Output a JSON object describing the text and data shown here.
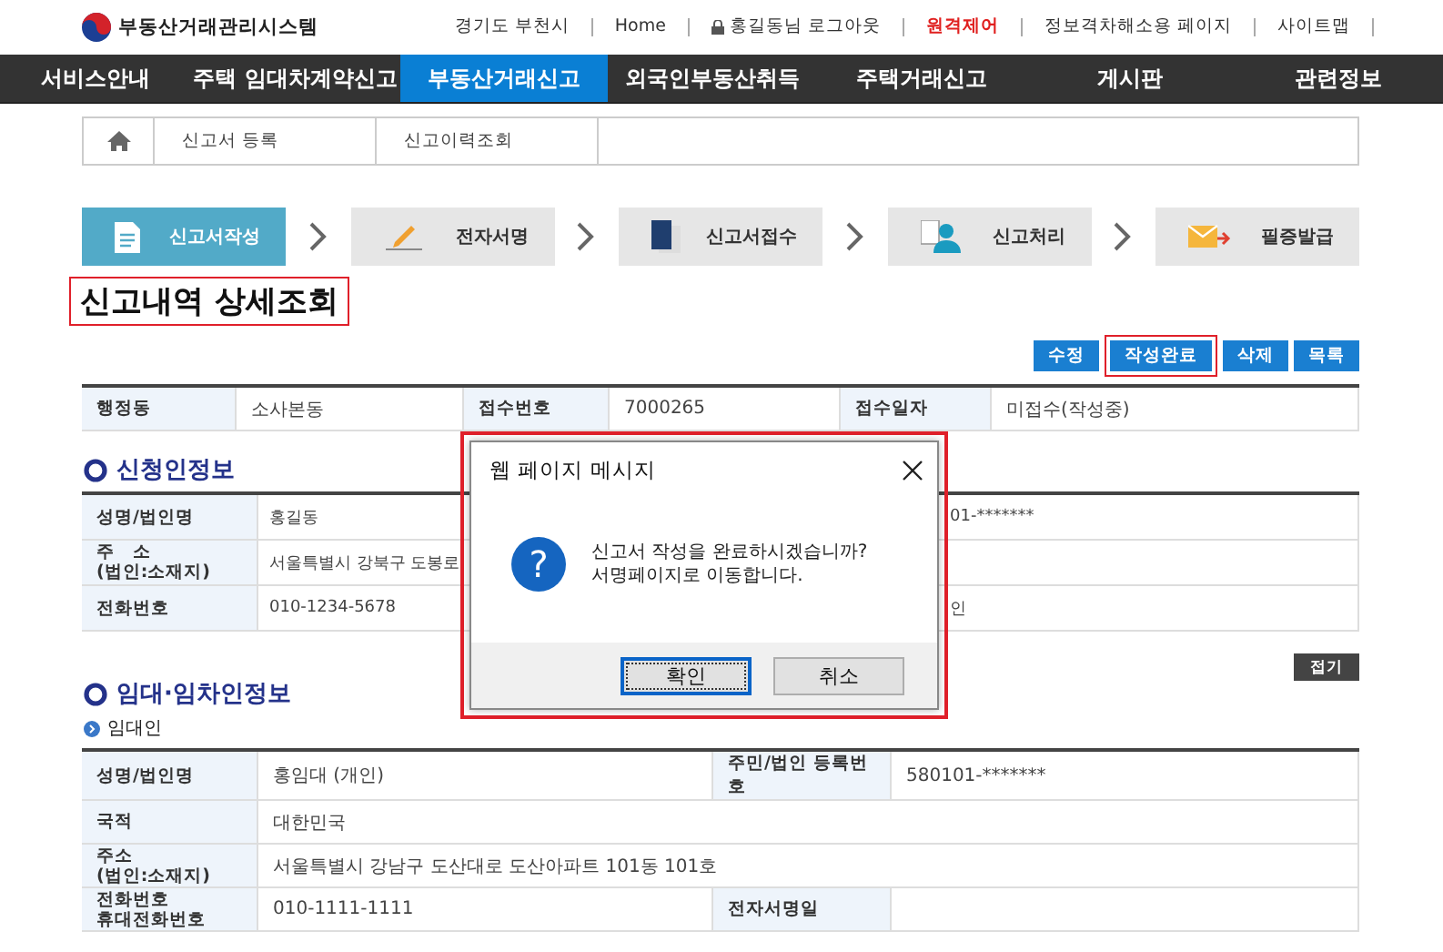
{
  "header": {
    "logo": "부동산거래관리시스템",
    "links": [
      {
        "label": "경기도 부천시",
        "kind": "text"
      },
      {
        "label": "Home",
        "kind": "link"
      },
      {
        "label": "홍길동님 로그아웃",
        "kind": "lock"
      },
      {
        "label": "원격제어",
        "kind": "alert"
      },
      {
        "label": "정보격차해소용 페이지",
        "kind": "link"
      },
      {
        "label": "사이트맵",
        "kind": "link"
      }
    ]
  },
  "nav": [
    {
      "label": "서비스안내",
      "selected": false
    },
    {
      "label": "주택 임대차계약신고",
      "selected": false
    },
    {
      "label": "부동산거래신고",
      "selected": true
    },
    {
      "label": "외국인부동산취득",
      "selected": false
    },
    {
      "label": "주택거래신고",
      "selected": false
    },
    {
      "label": "게시판",
      "selected": false
    },
    {
      "label": "관련정보",
      "selected": false
    }
  ],
  "breadcrumb": [
    "신고서 등록",
    "신고이력조회"
  ],
  "steps": [
    {
      "label": "신고서작성",
      "kind": "document",
      "selected": true
    },
    {
      "label": "전자서명",
      "kind": "pen",
      "selected": false
    },
    {
      "label": "신고서접수",
      "kind": "folder",
      "selected": false
    },
    {
      "label": "신고처리",
      "kind": "person",
      "selected": false
    },
    {
      "label": "필증발급",
      "kind": "envelope",
      "selected": false
    }
  ],
  "title": {
    "text": "신고내역 상세조회",
    "highlighted": true
  },
  "actions": [
    {
      "label": "수정",
      "highlighted": false
    },
    {
      "label": "작성완료",
      "highlighted": true
    },
    {
      "label": "삭제",
      "highlighted": false
    },
    {
      "label": "목록",
      "highlighted": false
    }
  ],
  "summary": [
    {
      "label": "행정동",
      "value": "소사본동"
    },
    {
      "label": "접수번호",
      "value": "7000265"
    },
    {
      "label": "접수일자",
      "value": "미접수(작성중)"
    }
  ],
  "applicant": {
    "title": "신청인정보",
    "rows": [
      {
        "label": [
          "성명/법인명"
        ],
        "value": "홍길동",
        "value_2": "01-*******"
      },
      {
        "label": [
          "주   소",
          "(법인:소재지)"
        ],
        "value": "서울특별시 강북구 도봉로"
      },
      {
        "label": [
          "전화번호"
        ],
        "value": "010-1234-5678",
        "value_2": "인"
      }
    ]
  },
  "parties": {
    "title": "임대·임차인정보",
    "toggle": "접기",
    "subtitle": "임대인",
    "rows": [
      {
        "label": [
          "성명/법인명"
        ],
        "value": "홍임대 (개인)",
        "label_2": "주민/법인 등록번호",
        "value_2": "580101-*******"
      },
      {
        "label": [
          "국적"
        ],
        "value": "대한민국"
      },
      {
        "label": [
          "주소",
          "(법인:소재지)"
        ],
        "value": "서울특별시 강남구 도산대로 도산아파트 101동 101호"
      },
      {
        "label": [
          "전화번호",
          "휴대전화번호"
        ],
        "value": "010-1111-1111",
        "label_2": "전자서명일"
      }
    ]
  },
  "dialog": {
    "title": "웹 페이지 메시지",
    "icon": "?",
    "message": [
      "신고서 작성을 완료하시겠습니까?",
      "서명페이지로 이동합니다."
    ],
    "highlighted": true,
    "buttons": [
      {
        "label": "확인",
        "selected": true
      },
      {
        "label": "취소",
        "selected": false
      }
    ]
  }
}
